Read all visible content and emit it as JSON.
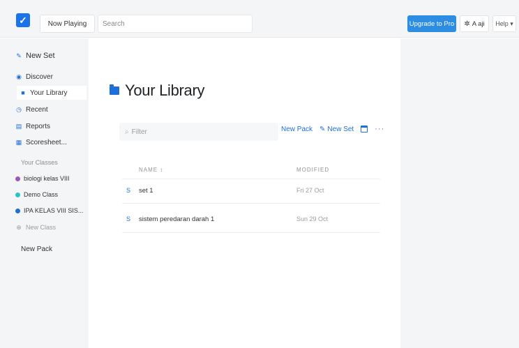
{
  "topbar": {
    "now_playing": "Now Playing",
    "search_placeholder": "Search",
    "upgrade": "Upgrade to Pro",
    "user": "A aji",
    "help": "Help ▾"
  },
  "sidebar": {
    "new_set": "New Set",
    "items": [
      {
        "label": "Discover",
        "icon": "compass-icon"
      },
      {
        "label": "Your Library",
        "icon": "folder-icon"
      },
      {
        "label": "Recent",
        "icon": "clock-icon"
      },
      {
        "label": "Reports",
        "icon": "report-icon"
      },
      {
        "label": "Scoresheet...",
        "icon": "grid-icon"
      }
    ],
    "classes_heading": "Your Classes",
    "classes": [
      {
        "label": "biologi kelas VIII",
        "color": "#9b59b6"
      },
      {
        "label": "Demo Class",
        "color": "#27c3c9"
      },
      {
        "label": "IPA KELAS VIII SIS...",
        "color": "#1e6fd9"
      }
    ],
    "new_class": "New Class",
    "new_pack": "New Pack"
  },
  "main": {
    "title": "Your Library",
    "filter_placeholder": "Filter",
    "actions": {
      "new_pack": "New Pack",
      "new_set": "New Set",
      "more": "···"
    },
    "columns": {
      "name": "NAME ↕",
      "modified": "MODIFIED"
    },
    "rows": [
      {
        "num": "S",
        "name": "set 1",
        "modified": "Fri 27 Oct"
      },
      {
        "num": "S",
        "name": "sistem peredaran darah 1",
        "modified": "Sun 29 Oct"
      }
    ]
  },
  "colors": {
    "accent": "#1e6fd9",
    "upgrade": "#2d8de3",
    "sidebar_bg": "#f4f5f7"
  }
}
